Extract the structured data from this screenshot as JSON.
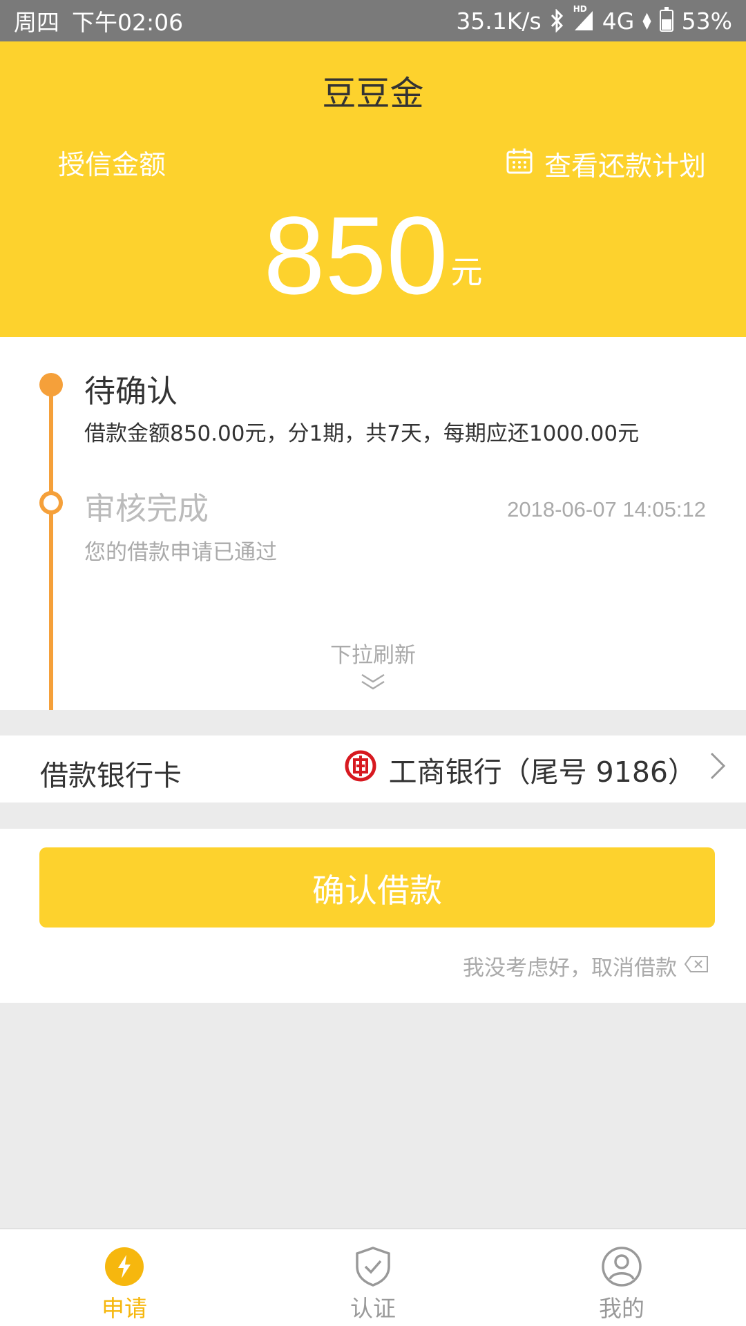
{
  "status_bar": {
    "day": "周四",
    "time": "下午02:06",
    "net_speed": "35.1K/s",
    "hd": "HD",
    "network": "4G",
    "battery": "53%"
  },
  "header": {
    "title": "豆豆金",
    "credit_label": "授信金额",
    "plan_link": "查看还款计划",
    "amount": "850",
    "amount_unit": "元"
  },
  "timeline": {
    "steps": [
      {
        "title": "待确认",
        "desc": "借款金额850.00元，分1期，共7天，每期应还1000.00元"
      },
      {
        "title": "审核完成",
        "time": "2018-06-07 14:05:12",
        "desc": "您的借款申请已通过"
      }
    ],
    "pull_refresh": "下拉刷新"
  },
  "bank_card": {
    "label": "借款银行卡",
    "bank_name": "工商银行（尾号 9186）"
  },
  "actions": {
    "confirm_label": "确认借款",
    "cancel_label": "我没考虑好，取消借款"
  },
  "tabbar": {
    "tabs": [
      {
        "label": "申请",
        "icon": "lightning-icon",
        "active": true
      },
      {
        "label": "认证",
        "icon": "shield-check-icon",
        "active": false
      },
      {
        "label": "我的",
        "icon": "user-icon",
        "active": false
      }
    ]
  },
  "colors": {
    "brand_yellow": "#fdd22d",
    "timeline_orange": "#f5a03a",
    "active_tab": "#f6b70e",
    "icbc_red": "#d71920"
  }
}
